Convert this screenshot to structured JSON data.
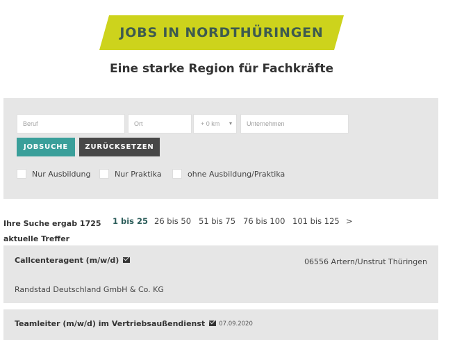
{
  "header": {
    "banner_title": "JOBS IN NORDTHÜRINGEN",
    "subtitle": "Eine starke Region für Fachkräfte"
  },
  "search": {
    "beruf_placeholder": "Beruf",
    "ort_placeholder": "Ort",
    "radius_value": "+ 0 km",
    "unternehmen_placeholder": "Unternehmen",
    "search_button": "JOBSUCHE",
    "reset_button": "ZURÜCKSETZEN",
    "filters": [
      {
        "label": "Nur Ausbildung",
        "checked": false
      },
      {
        "label": "Nur Praktika",
        "checked": false
      },
      {
        "label": "ohne Ausbildung/Praktika",
        "checked": false
      }
    ]
  },
  "results": {
    "summary_line1": "Ihre Suche ergab 1725",
    "summary_line2": "aktuelle Treffer",
    "pages": [
      "1 bis 25",
      "26 bis 50",
      "51 bis 75",
      "76 bis 100",
      "101 bis 125",
      ">"
    ],
    "active_page": "1 bis 25"
  },
  "jobs": [
    {
      "title": "Callcenteragent (m/w/d)",
      "icon": "mail-icon",
      "date": "",
      "location": "06556 Artern/Unstrut Thüringen",
      "company": "Randstad Deutschland GmbH & Co. KG"
    },
    {
      "title": "Teamleiter (m/w/d) im Vertriebsaußendienst",
      "icon": "mail-icon",
      "date": "07.09.2020",
      "location": "",
      "company": ""
    }
  ],
  "colors": {
    "banner": "#cdd31c",
    "banner_text": "#3d5a4f",
    "search_button": "#3a9f9a",
    "reset_button": "#474747",
    "panel": "#e6e6e6"
  }
}
